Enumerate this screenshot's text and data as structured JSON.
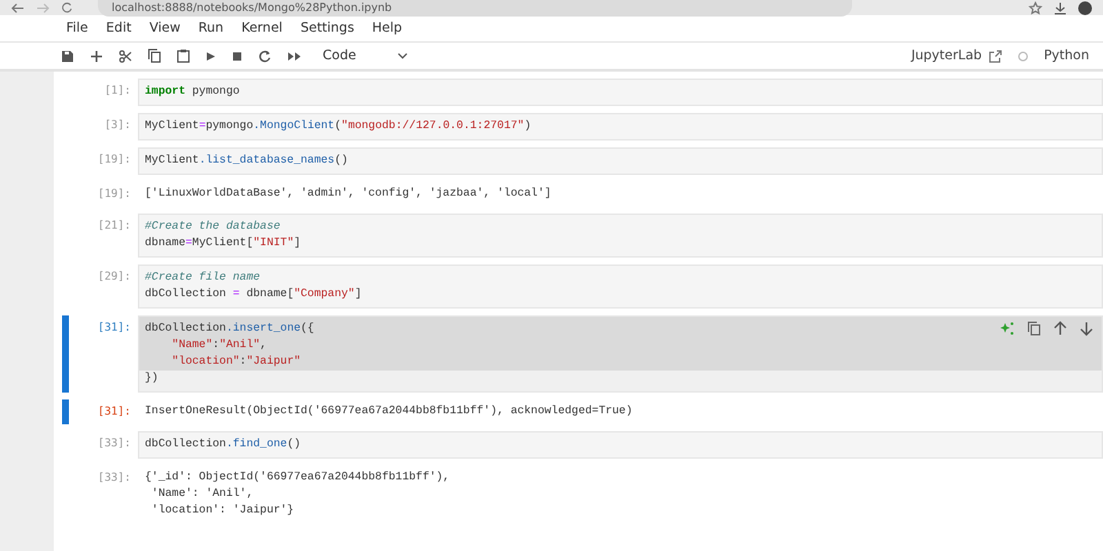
{
  "browser": {
    "url": "localhost:8888/notebooks/Mongo%28Python.ipynb"
  },
  "menu": [
    "File",
    "Edit",
    "View",
    "Run",
    "Kernel",
    "Settings",
    "Help"
  ],
  "toolbar": {
    "cell_type": "Code",
    "jupyterlab": "JupyterLab",
    "kernel": "Python"
  },
  "cells": [
    {
      "kind": "input",
      "prompt": "[1]:",
      "selected": false,
      "lines": [
        [
          {
            "text": "import",
            "kind": "keyword"
          },
          {
            "text": " pymongo",
            "kind": "plain"
          }
        ]
      ]
    },
    {
      "kind": "input",
      "prompt": "[3]:",
      "selected": false,
      "lines": [
        [
          {
            "text": "MyClient",
            "kind": "plain"
          },
          {
            "text": "=",
            "kind": "operator"
          },
          {
            "text": "pymongo",
            "kind": "plain"
          },
          {
            "text": ".MongoClient",
            "kind": "attribute"
          },
          {
            "text": "(",
            "kind": "plain"
          },
          {
            "text": "\"mongodb://127.0.0.1:27017\"",
            "kind": "string"
          },
          {
            "text": ")",
            "kind": "plain"
          }
        ]
      ]
    },
    {
      "kind": "input",
      "prompt": "[19]:",
      "selected": false,
      "lines": [
        [
          {
            "text": "MyClient",
            "kind": "plain"
          },
          {
            "text": ".list_database_names",
            "kind": "attribute"
          },
          {
            "text": "()",
            "kind": "plain"
          }
        ]
      ]
    },
    {
      "kind": "output",
      "prompt": "[19]:",
      "selected": false,
      "lines": [
        "['LinuxWorldDataBase', 'admin', 'config', 'jazbaa', 'local']"
      ]
    },
    {
      "kind": "input",
      "prompt": "[21]:",
      "selected": false,
      "lines": [
        [
          {
            "text": "#Create the database",
            "kind": "comment"
          }
        ],
        [
          {
            "text": "dbname",
            "kind": "plain"
          },
          {
            "text": "=",
            "kind": "operator"
          },
          {
            "text": "MyClient[",
            "kind": "plain"
          },
          {
            "text": "\"INIT\"",
            "kind": "string"
          },
          {
            "text": "]",
            "kind": "plain"
          }
        ]
      ]
    },
    {
      "kind": "input",
      "prompt": "[29]:",
      "selected": false,
      "lines": [
        [
          {
            "text": "#Create file name",
            "kind": "comment"
          }
        ],
        [
          {
            "text": "dbCollection ",
            "kind": "plain"
          },
          {
            "text": "=",
            "kind": "operator"
          },
          {
            "text": " dbname[",
            "kind": "plain"
          },
          {
            "text": "\"Company\"",
            "kind": "string"
          },
          {
            "text": "]",
            "kind": "plain"
          }
        ]
      ]
    },
    {
      "kind": "input",
      "prompt": "[31]:",
      "selected": true,
      "lines": [
        [
          {
            "text": "dbCollection",
            "kind": "plain"
          },
          {
            "text": ".insert_one",
            "kind": "attribute"
          },
          {
            "text": "({",
            "kind": "plain"
          }
        ],
        [
          {
            "text": "    \"Name\"",
            "kind": "string"
          },
          {
            "text": ":",
            "kind": "plain"
          },
          {
            "text": "\"Anil\"",
            "kind": "string"
          },
          {
            "text": ",",
            "kind": "plain"
          }
        ],
        [
          {
            "text": "    \"location\"",
            "kind": "string"
          },
          {
            "text": ":",
            "kind": "plain"
          },
          {
            "text": "\"Jaipur\"",
            "kind": "string"
          }
        ],
        [
          {
            "text": "})",
            "kind": "plain"
          }
        ]
      ]
    },
    {
      "kind": "output",
      "prompt": "[31]:",
      "selected": true,
      "lines": [
        "InsertOneResult(ObjectId('66977ea67a2044bb8fb11bff'), acknowledged=True)"
      ]
    },
    {
      "kind": "input",
      "prompt": "[33]:",
      "selected": false,
      "lines": [
        [
          {
            "text": "dbCollection",
            "kind": "plain"
          },
          {
            "text": ".find_one",
            "kind": "attribute"
          },
          {
            "text": "()",
            "kind": "plain"
          }
        ]
      ]
    },
    {
      "kind": "output",
      "prompt": "[33]:",
      "selected": false,
      "lines": [
        "{'_id': ObjectId('66977ea67a2044bb8fb11bff'),",
        " 'Name': 'Anil',",
        " 'location': 'Jaipur'}"
      ]
    }
  ]
}
